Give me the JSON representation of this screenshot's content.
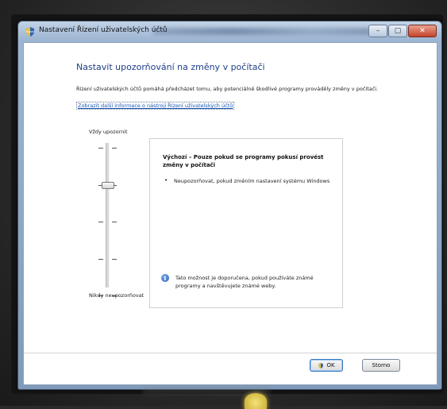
{
  "window": {
    "title": "Nastavení Řízení uživatelských účtů",
    "controls": [
      "–",
      "▢",
      "✕"
    ]
  },
  "main": {
    "heading": "Nastavit upozorňování na změny v počítači",
    "description": "Řízení uživatelských účtů pomáhá předcházet tomu, aby potenciálně škodlivé programy prováděly změny v počítači.",
    "link": "Zobrazit další informace o nástroji Řízení uživatelských účtů"
  },
  "slider": {
    "top_label": "Vždy upozornit",
    "bottom_label": "Nikdy neupozorňovat",
    "level": 3,
    "max_level": 4
  },
  "info_box": {
    "title": "Výchozí – Pouze pokud se programy pokusí provést změny v počítači",
    "bullet": "Neupozorňovat, pokud změním nastavení systému Windows",
    "note": "Tato možnost je doporučena, pokud používáte známé programy a navštěvujete známé weby."
  },
  "buttons": {
    "ok": "OK",
    "cancel": "Storno"
  },
  "icons": {
    "title_icon": "uac-shield-icon",
    "info_icon": "info-icon",
    "ok_icon": "uac-shield-icon"
  }
}
